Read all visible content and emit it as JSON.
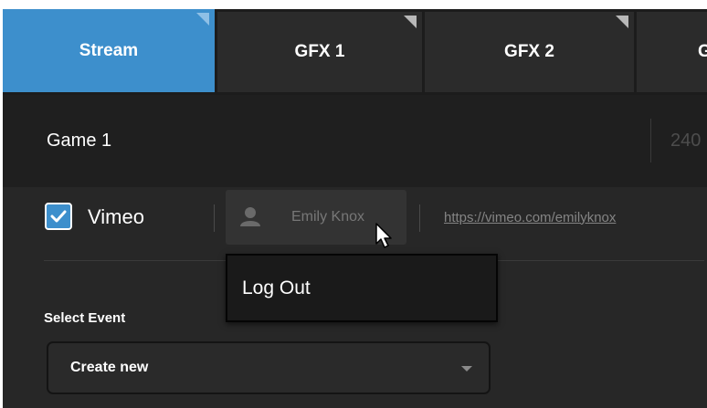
{
  "tabs": [
    {
      "label": "Stream",
      "active": true
    },
    {
      "label": "GFX 1",
      "active": false
    },
    {
      "label": "GFX 2",
      "active": false
    },
    {
      "label": "G",
      "active": false
    }
  ],
  "header": {
    "game_name": "Game 1",
    "resolution": "240"
  },
  "destination": {
    "enabled": true,
    "platform": "Vimeo",
    "account_name": "Emily Knox",
    "channel_url": "https://vimeo.com/emilyknox"
  },
  "account_menu": {
    "items": [
      "Log Out"
    ]
  },
  "event": {
    "label": "Select Event",
    "selected": "Create new"
  },
  "icons": {
    "user": "user-icon",
    "check": "check-icon",
    "caret": "caret-down-icon",
    "pointer": "mouse-pointer-icon"
  },
  "colors": {
    "accent": "#3d8fcc",
    "background": "#272727"
  }
}
